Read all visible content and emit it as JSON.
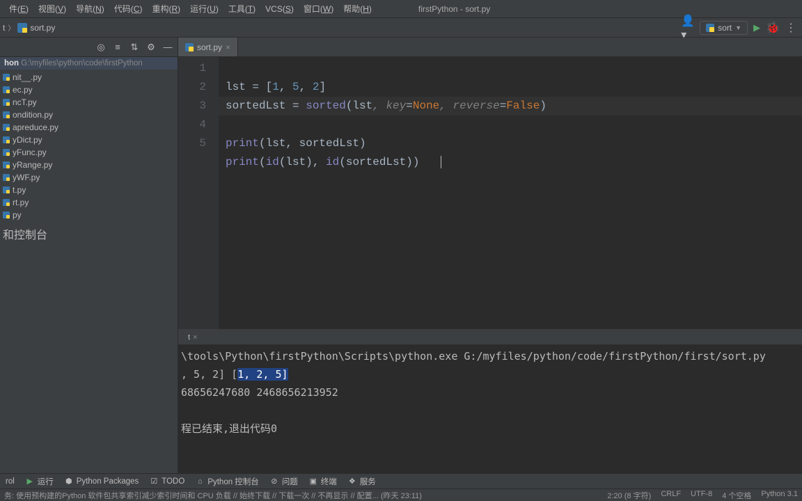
{
  "menubar": {
    "items": [
      {
        "label": "件",
        "mn": "E"
      },
      {
        "label": "视图",
        "mn": "V"
      },
      {
        "label": "导航",
        "mn": "N"
      },
      {
        "label": "代码",
        "mn": "C"
      },
      {
        "label": "重构",
        "mn": "R"
      },
      {
        "label": "运行",
        "mn": "U"
      },
      {
        "label": "工具",
        "mn": "T"
      },
      {
        "label": "VCS",
        "mn": "S"
      },
      {
        "label": "窗口",
        "mn": "W"
      },
      {
        "label": "帮助",
        "mn": "H"
      }
    ],
    "window_title": "firstPython - sort.py"
  },
  "navrow": {
    "breadcrumb_prefix": "t",
    "breadcrumb_file": "sort.py",
    "run_config_name": "sort"
  },
  "sidebar": {
    "project_label": "hon",
    "project_path": "G:\\myfiles\\python\\code\\firstPython",
    "files": [
      "nit__.py",
      "ec.py",
      "ncT.py",
      "ondition.py",
      "apreduce.py",
      "yDict.py",
      "yFunc.py",
      "yRange.py",
      "yWF.py",
      "t.py",
      "rt.py",
      "py"
    ],
    "section_label": "和控制台"
  },
  "editor": {
    "tab_name": "sort.py",
    "lines": [
      "1",
      "2",
      "3",
      "4",
      "5"
    ],
    "code": {
      "l1_a": "lst = [",
      "l1_n1": "1",
      "l1_c1": ", ",
      "l1_n2": "5",
      "l1_c2": ", ",
      "l1_n3": "2",
      "l1_b": "]",
      "l2_a": "sortedLst = ",
      "l2_fn": "sorted",
      "l2_p1": "(lst",
      "l2_cm1": ", ",
      "l2_k1": "key",
      "l2_eq1": "=",
      "l2_none": "None",
      "l2_cm2": ", ",
      "l2_k2": "reverse",
      "l2_eq2": "=",
      "l2_false": "False",
      "l2_p2": ")",
      "l3_fn": "print",
      "l3_rest": "(lst, sortedLst)",
      "l4_fn": "print",
      "l4_a": "(",
      "l4_id1": "id",
      "l4_b": "(lst), ",
      "l4_id2": "id",
      "l4_c": "(sortedLst))"
    }
  },
  "run": {
    "tab_label": "t",
    "out_line1": "\\tools\\Python\\firstPython\\Scripts\\python.exe G:/myfiles/python/code/firstPython/first/sort.py",
    "out_line2_a": ", 5, 2] [",
    "out_line2_sel": "1, 2, 5]",
    "out_line3": "68656247680 2468656213952",
    "out_finish": "程已结束,退出代码0"
  },
  "bottombar": {
    "items": [
      "rol",
      "运行",
      "Python Packages",
      "TODO",
      "Python 控制台",
      "问题",
      "终端",
      "服务"
    ]
  },
  "statusbar": {
    "left": "务: 使用预构建的Python 软件包共享索引减少索引时间和 CPU 负载 // 始终下载 // 下载一次 // 不再显示 // 配置... (昨天 23:11)",
    "pos": "2:20 (8 字符)",
    "eol": "CRLF",
    "enc": "UTF-8",
    "indent": "4 个空格",
    "python": "Python 3.1"
  }
}
